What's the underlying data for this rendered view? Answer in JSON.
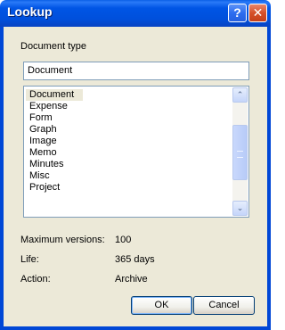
{
  "window": {
    "title": "Lookup",
    "help_glyph": "?",
    "close_glyph": "✕"
  },
  "document_type": {
    "label": "Document type",
    "value": "Document"
  },
  "list": {
    "items": [
      "Document",
      "Expense",
      "Form",
      "Graph",
      "Image",
      "Memo",
      "Minutes",
      "Misc",
      "Project"
    ],
    "selected": "Document"
  },
  "scrollbar": {
    "up_glyph": "⌃",
    "down_glyph": "⌄"
  },
  "details": {
    "max_versions_label": "Maximum versions:",
    "max_versions_value": "100",
    "life_label": "Life:",
    "life_value": "365 days",
    "action_label": "Action:",
    "action_value": "Archive"
  },
  "buttons": {
    "ok": "OK",
    "cancel": "Cancel"
  },
  "colors": {
    "title_bar": "#0055e5",
    "dialog_bg": "#ece9d8",
    "field_border": "#7f9db9"
  }
}
